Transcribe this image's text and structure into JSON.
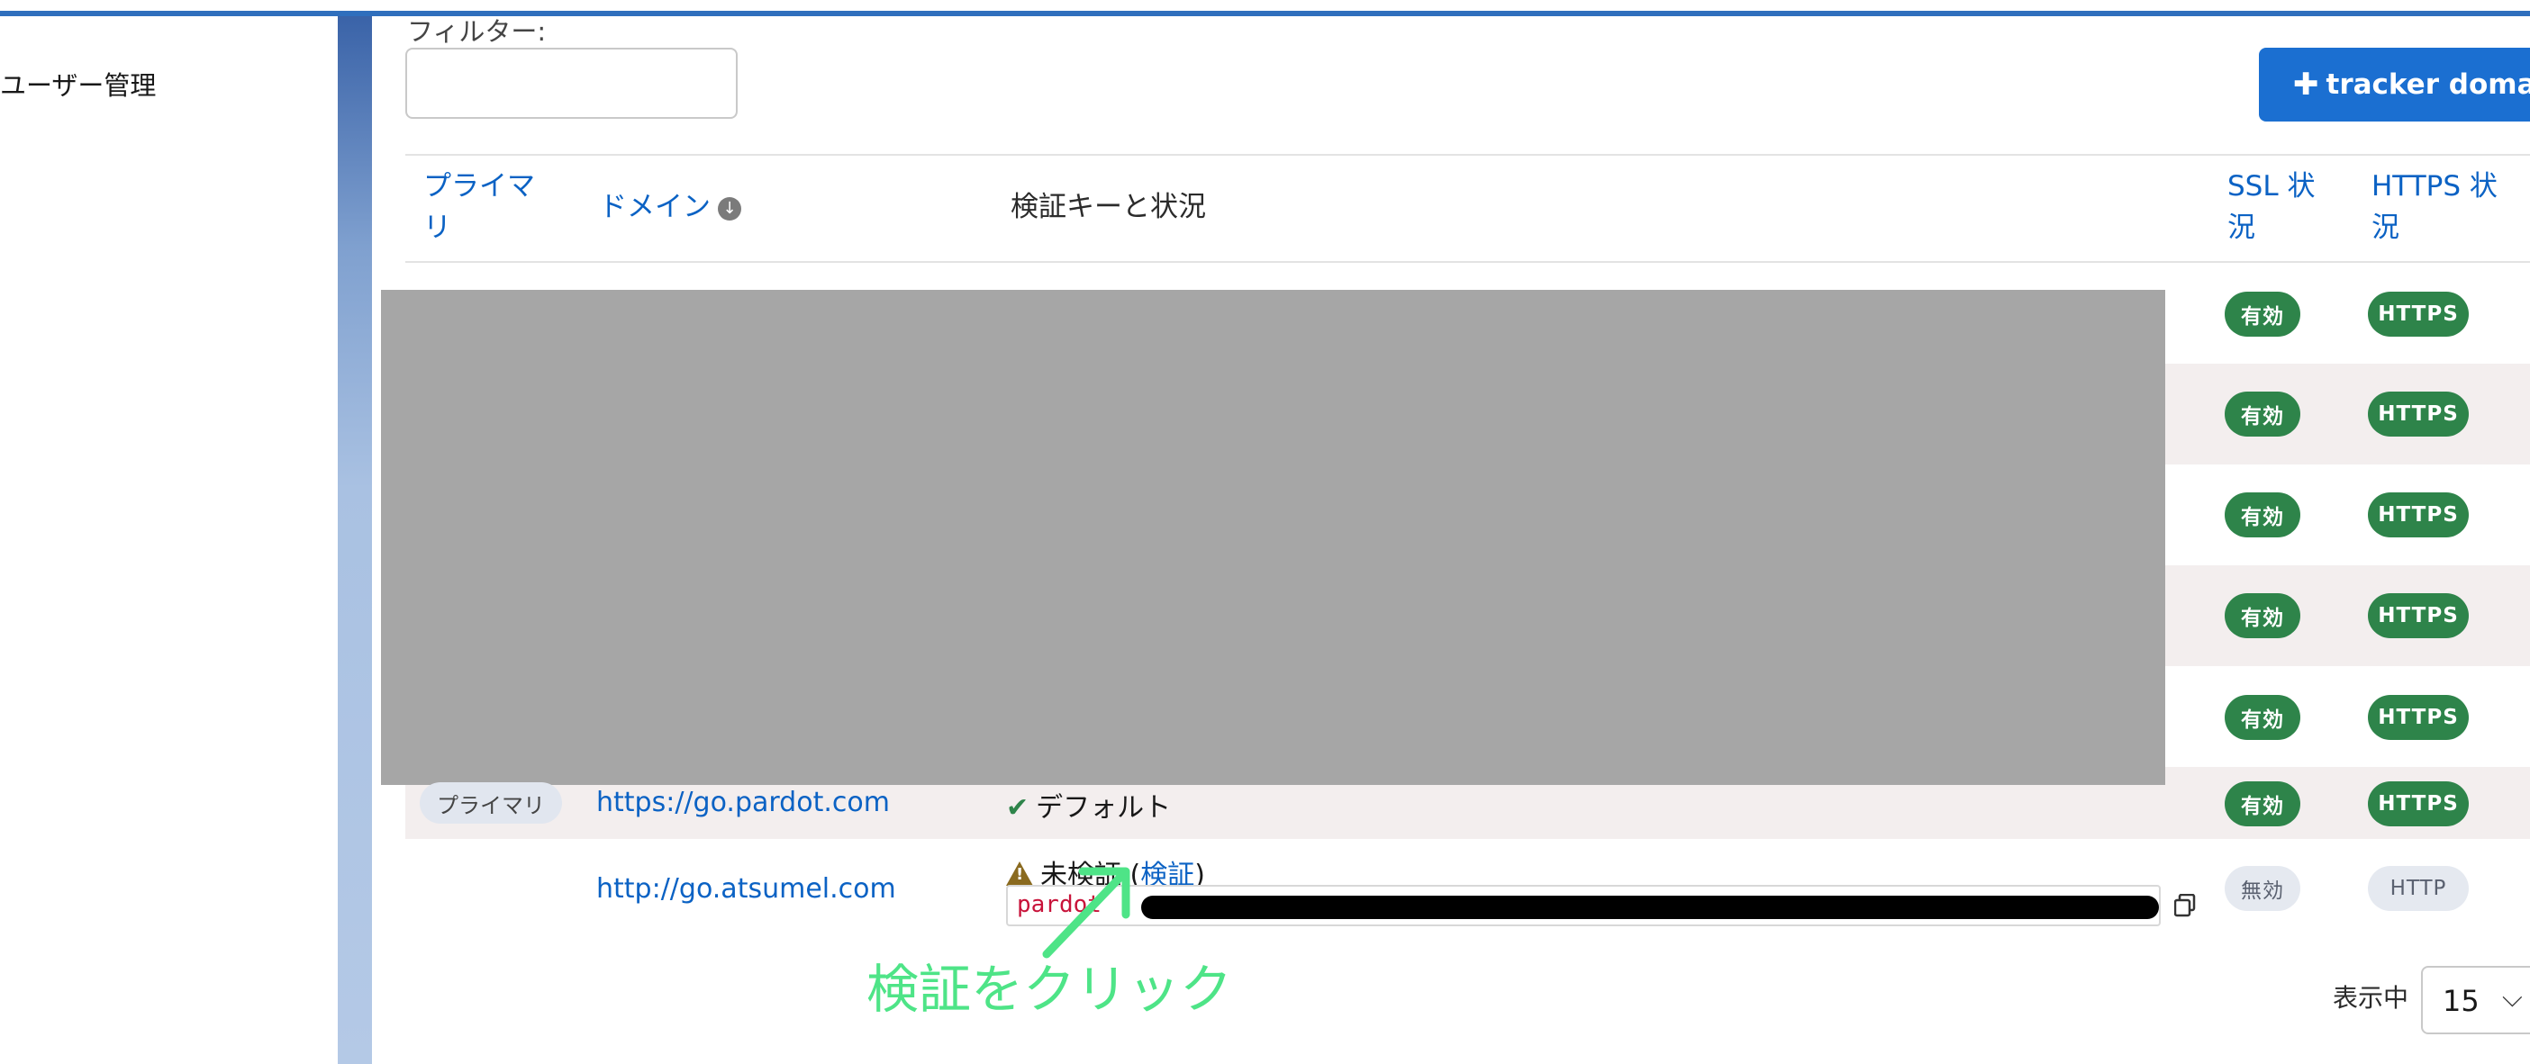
{
  "sidebar": {
    "user_management": "ユーザー管理"
  },
  "filter": {
    "label": "フィルター:",
    "value": ""
  },
  "add_button": {
    "label": "tracker domain"
  },
  "table": {
    "headers": {
      "primary": "プライマリ",
      "domain": "ドメイン",
      "verification": "検証キーと状況",
      "ssl": "SSL 状況",
      "https": "HTTPS 状況"
    },
    "redacted_rows": [
      {
        "ssl": "有効",
        "https": "HTTPS"
      },
      {
        "ssl": "有効",
        "https": "HTTPS"
      },
      {
        "ssl": "有効",
        "https": "HTTPS"
      },
      {
        "ssl": "有効",
        "https": "HTTPS"
      },
      {
        "ssl": "有効",
        "https": "HTTPS"
      }
    ],
    "row_default": {
      "primary_badge": "プライマリ",
      "domain": "https://go.pardot.com",
      "status": "デフォルト",
      "ssl": "有効",
      "https": "HTTPS"
    },
    "row_unverified": {
      "domain": "http://go.atsumel.com",
      "status": "未検証",
      "verify_open": "(",
      "verify_link": "検証",
      "verify_close": ")",
      "key_prefix": "pardot",
      "ssl": "無効",
      "https": "HTTP"
    }
  },
  "annotation": {
    "text": "検証をクリック"
  },
  "pagination": {
    "label": "表示中",
    "page_size": "15"
  },
  "colors": {
    "accent": "#1b6fd1",
    "link": "#0b62c4",
    "valid": "#2e844a",
    "annotation": "#4ee487"
  },
  "icons": [
    "plus-icon",
    "sort-down-icon",
    "check-icon",
    "warning-icon",
    "copy-icon",
    "chevron-down-icon"
  ]
}
